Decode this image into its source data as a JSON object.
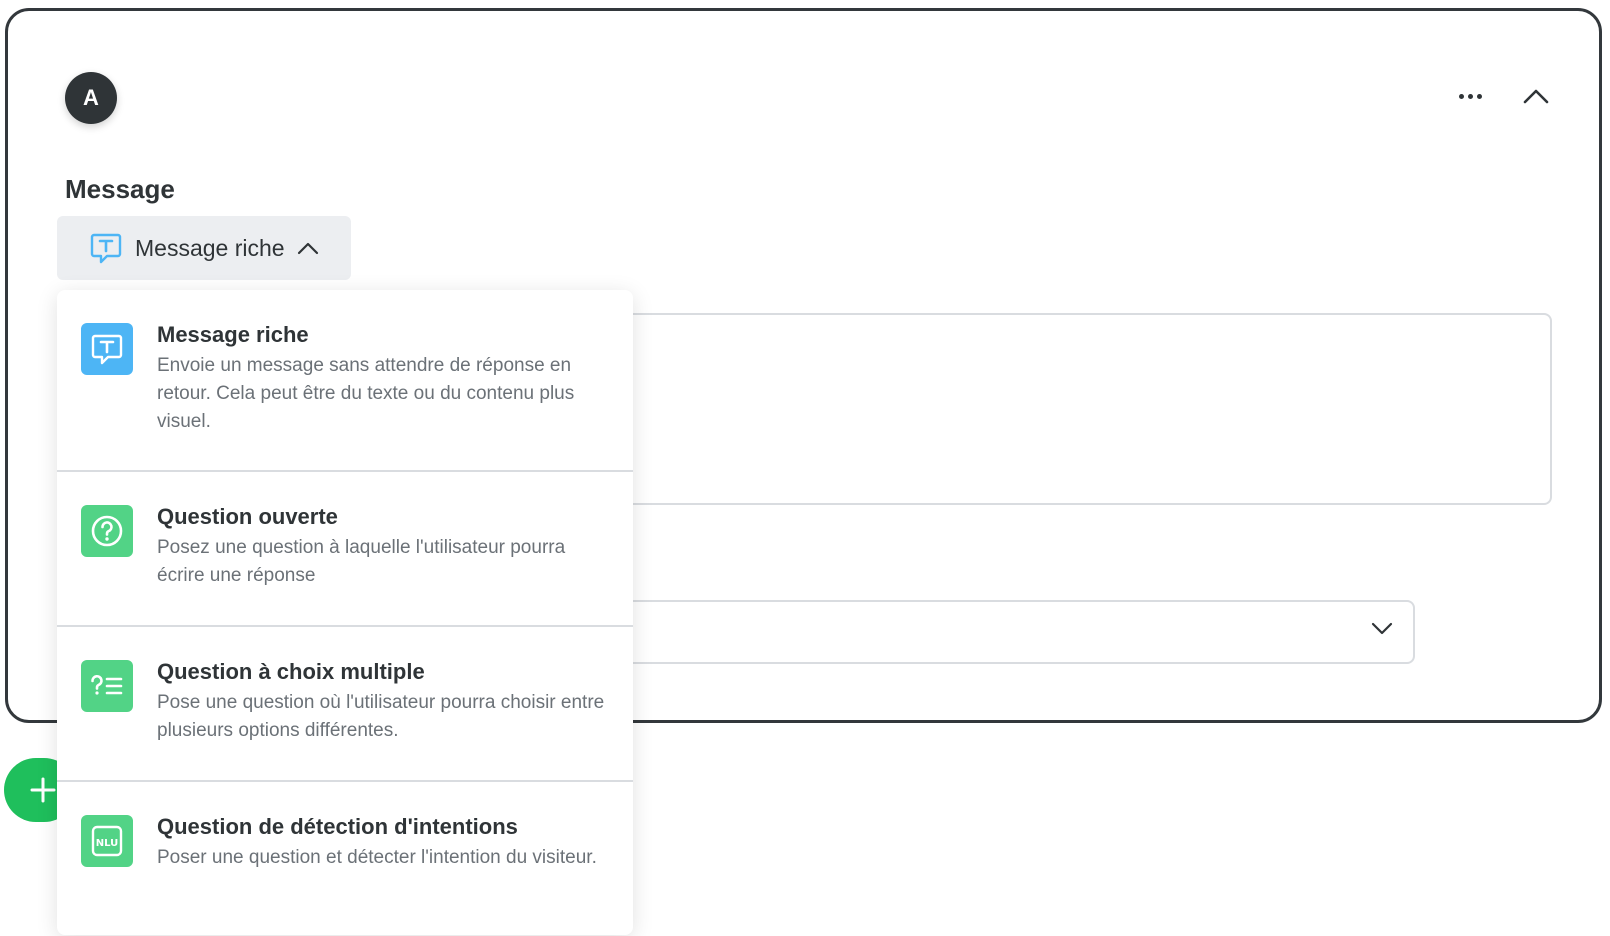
{
  "card": {
    "avatar_letter": "A",
    "section_label": "Message"
  },
  "type_select": {
    "label": "Message riche"
  },
  "dropdown": {
    "options": [
      {
        "title": "Message riche",
        "desc": "Envoie un message sans attendre de réponse en retour. Cela peut être du texte ou du contenu plus visuel.",
        "icon": "rich-message-icon",
        "color": "#4db5f5"
      },
      {
        "title": "Question ouverte",
        "desc": "Posez une question à laquelle l'utilisateur pourra écrire une réponse",
        "icon": "question-circle-icon",
        "color": "#52d386"
      },
      {
        "title": "Question à choix multiple",
        "desc": "Pose une question où l'utilisateur pourra choisir entre plusieurs options différentes.",
        "icon": "multiple-choice-icon",
        "color": "#52d386"
      },
      {
        "title": "Question de détection d'intentions",
        "desc": "Poser une question et détecter l'intention du visiteur.",
        "icon": "nlu-icon",
        "icon_text": "NLU",
        "color": "#52d386"
      }
    ]
  },
  "colors": {
    "accent_blue": "#4db5f5",
    "accent_green": "#52d386",
    "add_button": "#1fbf5c",
    "card_border": "#33383c"
  }
}
